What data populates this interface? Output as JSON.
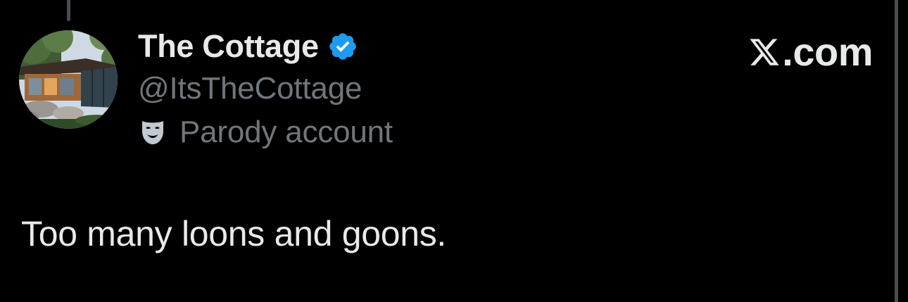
{
  "author": {
    "display_name": "The Cottage",
    "handle": "@ItsTheCottage",
    "label": "Parody account",
    "verified": true,
    "badge_icon": "verified-badge-icon",
    "label_icon": "theater-mask-icon"
  },
  "brand": {
    "icon": "x-logo-icon",
    "text": ".com"
  },
  "post": {
    "text": "Too many loons and goons."
  },
  "colors": {
    "background": "#000000",
    "primary_text": "#e7e9ea",
    "secondary_text": "#71767b",
    "verified_blue": "#1d9bf0",
    "divider": "#4a4d50"
  }
}
